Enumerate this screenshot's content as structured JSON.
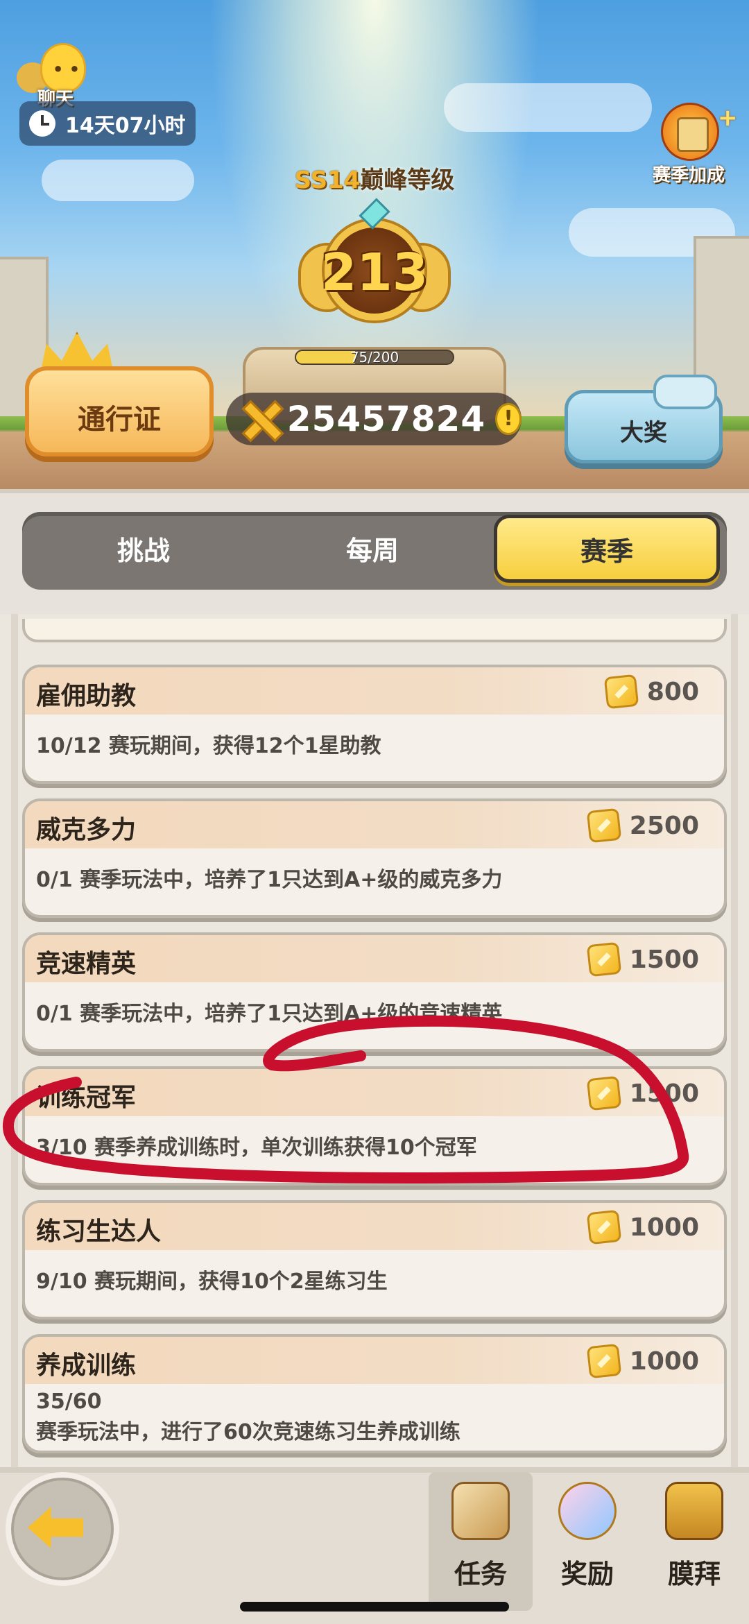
{
  "header": {
    "chat_label": "聊天",
    "timer": "14天07小时",
    "season_bonus_label": "赛季加成",
    "rank_prefix": "SS14",
    "rank_title": "巅峰等级",
    "level": "213",
    "xp_text": "75/200",
    "xp_progress": 0.375,
    "pass_label": "通行证",
    "coins": "25457824",
    "grand_prize_label": "大奖"
  },
  "tabs": [
    {
      "label": "挑战",
      "active": false
    },
    {
      "label": "每周",
      "active": false
    },
    {
      "label": "赛季",
      "active": true
    }
  ],
  "tasks": [
    {
      "title": "雇佣助教",
      "reward": "800",
      "desc": "10/12 赛玩期间，获得12个1星助教"
    },
    {
      "title": "威克多力",
      "reward": "2500",
      "desc": "0/1 赛季玩法中，培养了1只达到A+级的威克多力"
    },
    {
      "title": "竞速精英",
      "reward": "1500",
      "desc": "0/1 赛季玩法中，培养了1只达到A+级的竞速精英"
    },
    {
      "title": "训练冠军",
      "reward": "1500",
      "desc": "3/10 赛季养成训练时，单次训练获得10个冠军"
    },
    {
      "title": "练习生达人",
      "reward": "1000",
      "desc": "9/10 赛玩期间，获得10个2星练习生"
    },
    {
      "title": "养成训练",
      "reward": "1000",
      "desc_progress": "35/60",
      "desc": "赛季玩法中，进行了60次竞速练习生养成训练"
    }
  ],
  "nav": [
    {
      "label": "任务",
      "icon": "scroll-task-icon",
      "active": true
    },
    {
      "label": "奖励",
      "icon": "gift-reward-icon",
      "active": false
    },
    {
      "label": "膜拜",
      "icon": "totem-worship-icon",
      "active": false
    }
  ],
  "colors": {
    "accent_gold": "#f7cf3e",
    "annotation_red": "#c8102e",
    "card_bg": "#f5f1ea"
  }
}
